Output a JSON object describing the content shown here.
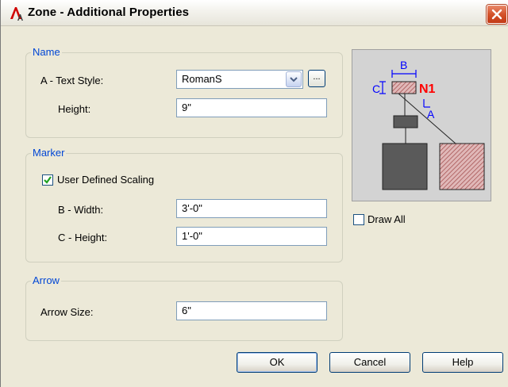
{
  "window": {
    "title": "Zone - Additional Properties",
    "icon": "autocad-icon",
    "close_icon": "close-icon"
  },
  "name_group": {
    "label": "Name",
    "text_style_label": "A - Text Style:",
    "text_style_value": "RomanS",
    "browse_label": "...",
    "height_label": "Height:",
    "height_value": "9\""
  },
  "marker_group": {
    "label": "Marker",
    "user_defined_scaling_label": "User Defined Scaling",
    "user_defined_scaling_checked": true,
    "width_label": "B - Width:",
    "width_value": "3'-0\"",
    "height_label": "C - Height:",
    "height_value": "1'-0\""
  },
  "arrow_group": {
    "label": "Arrow",
    "arrow_size_label": "Arrow Size:",
    "arrow_size_value": "6\""
  },
  "preview": {
    "label_b": "B",
    "label_c": "C",
    "label_n1": "N1",
    "label_a": "A",
    "colors": {
      "blue": "#0000ff",
      "red": "#ff0000",
      "hatch": "#b05050",
      "fill": "#5a5a5a"
    }
  },
  "draw_all": {
    "label": "Draw All",
    "checked": false
  },
  "buttons": {
    "ok": "OK",
    "cancel": "Cancel",
    "help": "Help"
  }
}
